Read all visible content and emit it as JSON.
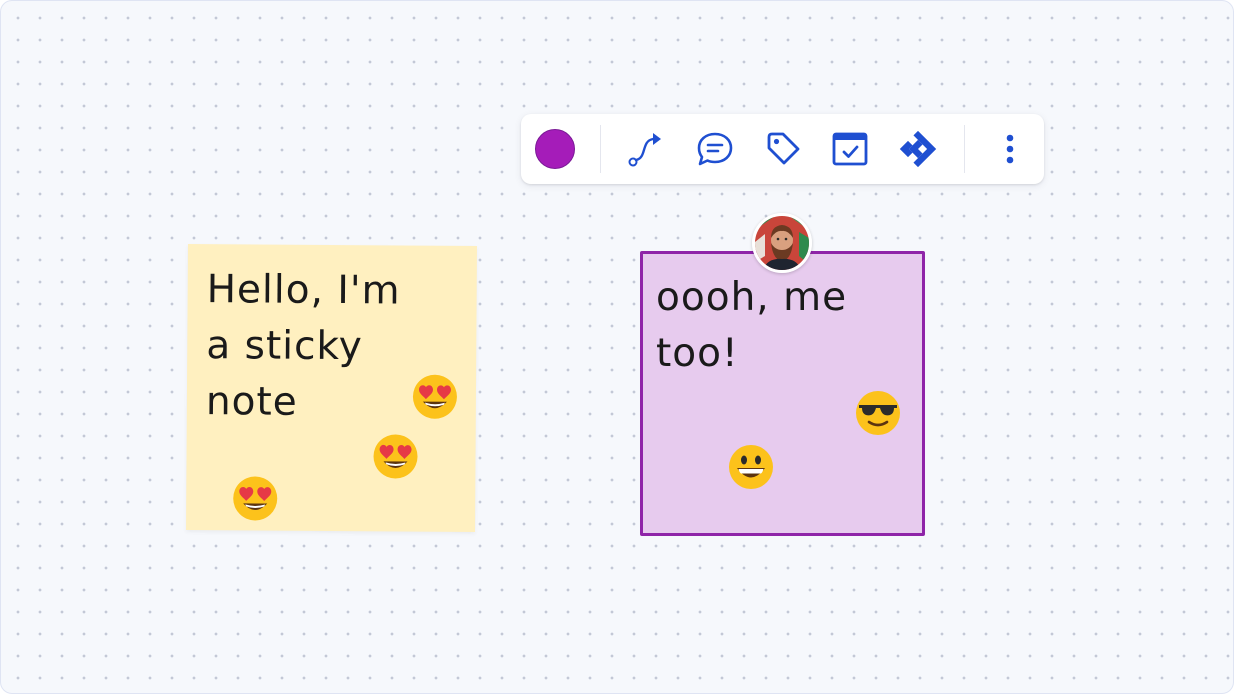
{
  "toolbar": {
    "color_swatch": "#a51cb9",
    "accent": "#1f4fd1",
    "items": [
      {
        "name": "color-swatch",
        "icon": "color-swatch"
      },
      {
        "name": "connector",
        "icon": "connector-icon"
      },
      {
        "name": "comment",
        "icon": "comment-icon"
      },
      {
        "name": "tag",
        "icon": "tag-icon"
      },
      {
        "name": "date",
        "icon": "calendar-icon"
      },
      {
        "name": "jira",
        "icon": "jira-icon"
      },
      {
        "name": "more",
        "icon": "more-vertical-icon"
      }
    ]
  },
  "notes": [
    {
      "color": "#fff0c0",
      "text": "Hello, I'm\na sticky\nnote",
      "reactions": [
        "heart-eyes-emoji",
        "heart-eyes-emoji",
        "heart-eyes-emoji"
      ]
    },
    {
      "color": "#e7cbee",
      "border": "#8f24a8",
      "text": "oooh, me\ntoo!",
      "selected": true,
      "reactions": [
        "sunglasses-emoji",
        "grinning-emoji"
      ]
    }
  ],
  "collaborator": {
    "avatar_icon": "user-avatar"
  }
}
